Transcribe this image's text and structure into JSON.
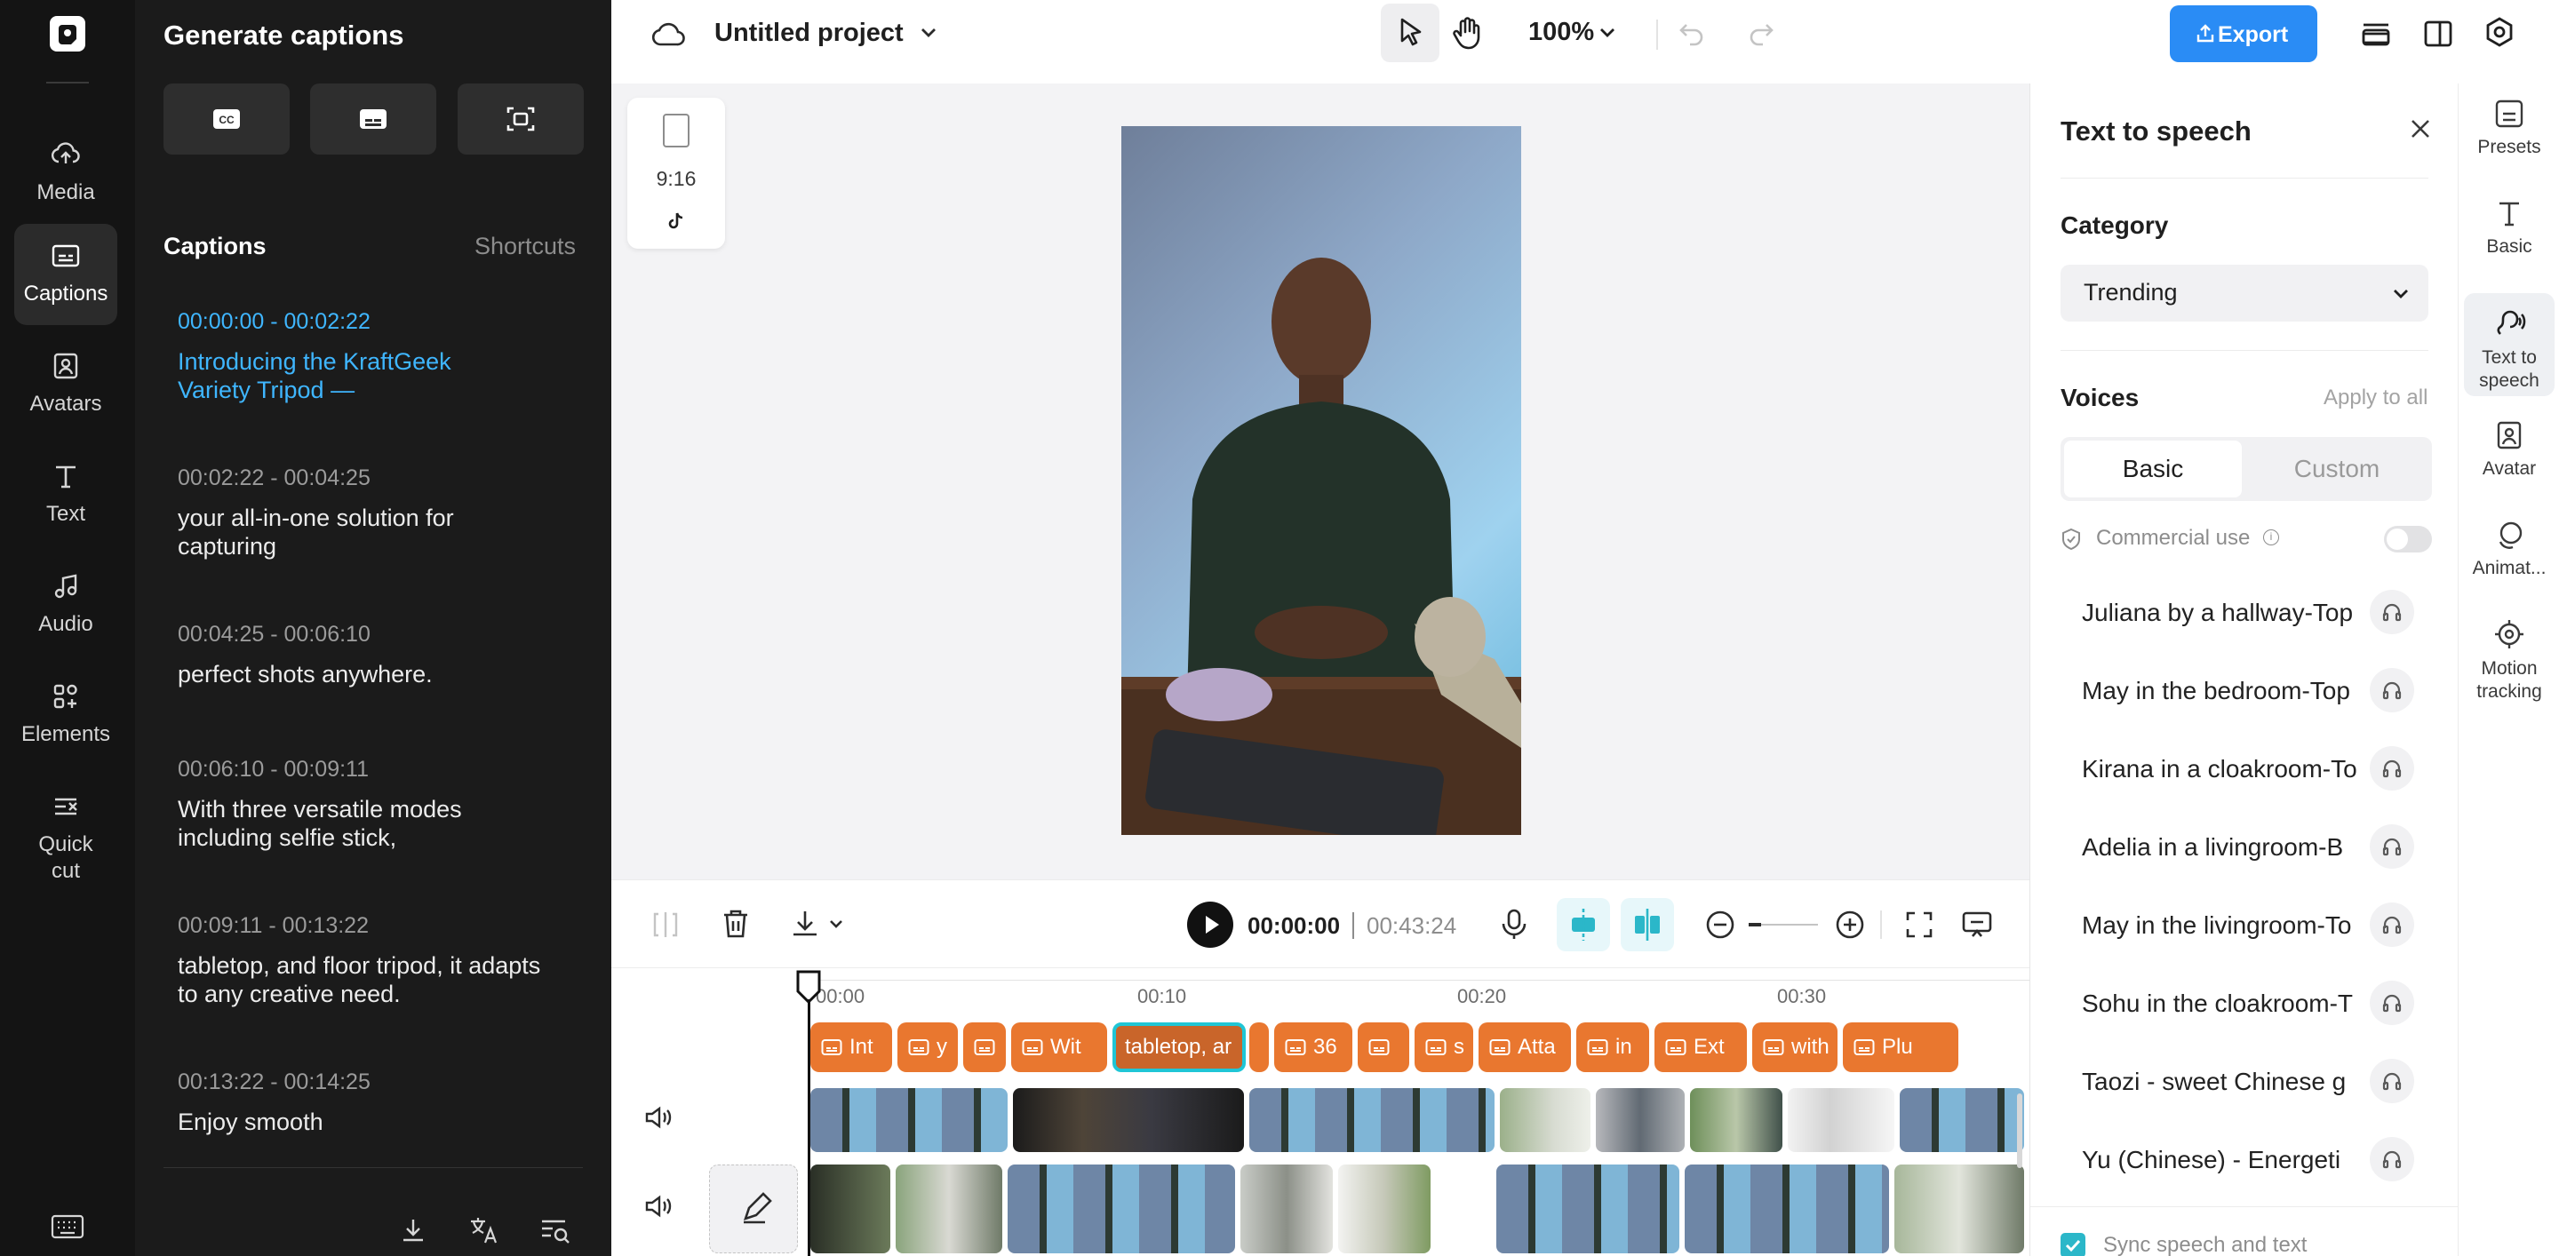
{
  "sidebar": {
    "items": [
      {
        "label": "Media",
        "icon": "cloud-upload-icon"
      },
      {
        "label": "Captions",
        "icon": "captions-icon",
        "active": true
      },
      {
        "label": "Avatars",
        "icon": "avatar-icon"
      },
      {
        "label": "Text",
        "icon": "text-icon"
      },
      {
        "label": "Audio",
        "icon": "music-note-icon"
      },
      {
        "label": "Elements",
        "icon": "elements-icon"
      },
      {
        "label": "Quick cut",
        "icon": "scissors-icon"
      }
    ]
  },
  "captions_panel": {
    "title": "Generate captions",
    "section": "Captions",
    "shortcuts": "Shortcuts",
    "entries": [
      {
        "time": "00:00:00 - 00:02:22",
        "text": "Introducing the KraftGeek Variety Tripod —"
      },
      {
        "time": "00:02:22 - 00:04:25",
        "text": "your all-in-one solution for capturing"
      },
      {
        "time": "00:04:25 - 00:06:10",
        "text": "perfect shots anywhere."
      },
      {
        "time": "00:06:10 - 00:09:11",
        "text": "With three versatile modes including selfie stick,"
      },
      {
        "time": "00:09:11 - 00:13:22",
        "text": "tabletop, and floor tripod, it adapts to any creative need."
      },
      {
        "time": "00:13:22 - 00:14:25",
        "text": "Enjoy smooth"
      }
    ]
  },
  "topbar": {
    "project_name": "Untitled project",
    "zoom": "100%",
    "export_label": "Export"
  },
  "canvas": {
    "ratio": "9:16"
  },
  "tts": {
    "title": "Text to speech",
    "category_label": "Category",
    "category_value": "Trending",
    "voices_label": "Voices",
    "apply_all": "Apply to all",
    "tab_basic": "Basic",
    "tab_custom": "Custom",
    "commercial": "Commercial use",
    "voices": [
      "Juliana by a hallway-Top",
      "May in the bedroom-Top",
      "Kirana in a cloakroom-To",
      "Adelia in a livingroom-B",
      "May in the livingroom-To",
      "Sohu in the cloakroom-T",
      "Taozi - sweet Chinese g",
      "Yu (Chinese) - Energeti"
    ],
    "sync": "Sync speech and text"
  },
  "right_tools": [
    {
      "label": "Presets",
      "icon": "presets-icon"
    },
    {
      "label": "Basic",
      "icon": "text-icon"
    },
    {
      "label": "Text to speech",
      "icon": "tts-icon",
      "active": true
    },
    {
      "label": "Avatar",
      "icon": "avatar-icon"
    },
    {
      "label": "Animat...",
      "icon": "animation-icon"
    },
    {
      "label": "Motion tracking",
      "icon": "motion-tracking-icon"
    }
  ],
  "timeline": {
    "current_time": "00:00:00",
    "total_time": "00:43:24",
    "ticks": [
      "00:00",
      "00:10",
      "00:20",
      "00:30"
    ],
    "caption_chips": [
      {
        "label": "Int"
      },
      {
        "label": "y"
      },
      {
        "label": ""
      },
      {
        "label": "Wit"
      },
      {
        "label": "tabletop, ar",
        "selected": true
      },
      {
        "label": ""
      },
      {
        "label": "36"
      },
      {
        "label": ""
      },
      {
        "label": "s"
      },
      {
        "label": "Atta"
      },
      {
        "label": "in"
      },
      {
        "label": "Ext"
      },
      {
        "label": "with"
      },
      {
        "label": "Plu"
      }
    ]
  },
  "colors": {
    "accent_blue": "#3fb6ff",
    "export_blue": "#2a8cf5",
    "caption_orange": "#e9772f",
    "selected_teal": "#1fc6d6"
  }
}
